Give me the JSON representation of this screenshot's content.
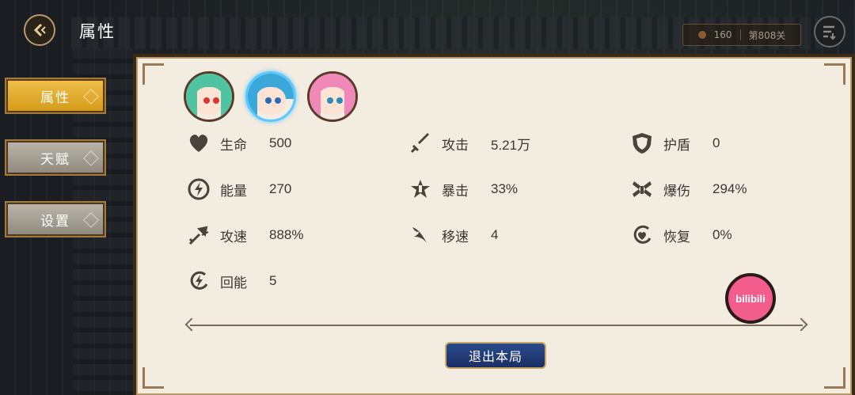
{
  "header": {
    "title": "属性",
    "counter_value": "160",
    "stage_label": "第808关"
  },
  "tabs": [
    {
      "label": "属性",
      "active": true
    },
    {
      "label": "天赋",
      "active": false
    },
    {
      "label": "设置",
      "active": false
    }
  ],
  "characters": [
    {
      "name_icon": "green-hair-character",
      "selected": false
    },
    {
      "name_icon": "blue-hair-character",
      "selected": true
    },
    {
      "name_icon": "pink-hair-character",
      "selected": false
    }
  ],
  "stats": [
    {
      "label": "生命",
      "value": "500",
      "icon": "heart-icon"
    },
    {
      "label": "攻击",
      "value": "5.21万",
      "icon": "sword-icon"
    },
    {
      "label": "护盾",
      "value": "0",
      "icon": "shield-icon"
    },
    {
      "label": "能量",
      "value": "270",
      "icon": "lightning-icon"
    },
    {
      "label": "暴击",
      "value": "33%",
      "icon": "crit-icon"
    },
    {
      "label": "爆伤",
      "value": "294%",
      "icon": "crit-damage-icon"
    },
    {
      "label": "攻速",
      "value": "888%",
      "icon": "attack-speed-icon"
    },
    {
      "label": "移速",
      "value": "4",
      "icon": "wing-icon"
    },
    {
      "label": "恢复",
      "value": "0%",
      "icon": "heal-icon"
    },
    {
      "label": "回能",
      "value": "5",
      "icon": "energy-regen-icon"
    }
  ],
  "actions": {
    "exit_label": "退出本局",
    "bili_label": "bilibili"
  },
  "colors": {
    "accent_gold": "#f0c04a",
    "panel_bg": "#f3ece0",
    "button_blue": "#2a4a8c",
    "bili_pink": "#f25d8e"
  }
}
